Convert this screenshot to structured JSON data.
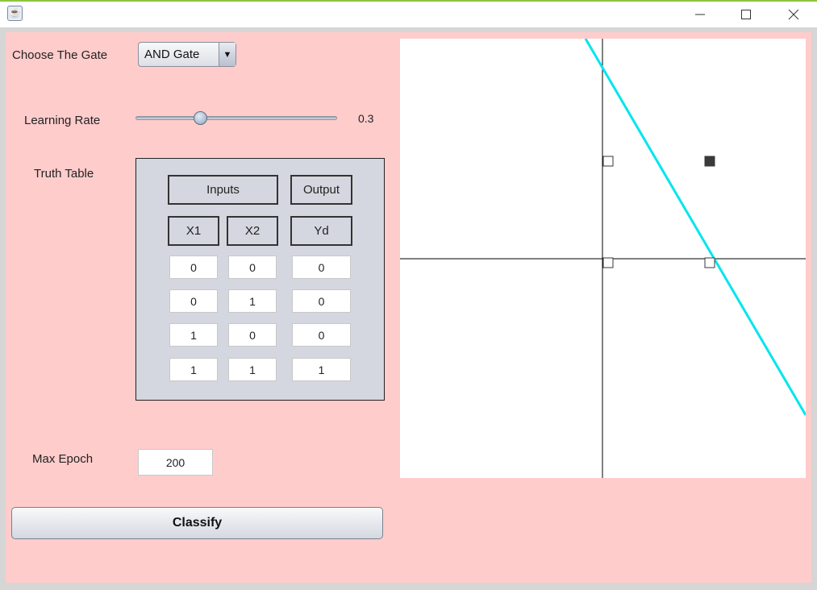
{
  "window": {
    "title": "",
    "minimize_glyph": "—",
    "maximize_glyph": "☐",
    "close_glyph": "✕"
  },
  "controls": {
    "gate_label": "Choose The Gate",
    "gate_selected": "AND Gate",
    "gate_arrow": "▼",
    "learning_rate_label": "Learning Rate",
    "learning_rate_value": "0.3",
    "learning_rate_fraction": 0.3,
    "truth_table_label": "Truth Table",
    "max_epoch_label": "Max Epoch",
    "max_epoch_value": "200",
    "classify_label": "Classify"
  },
  "truth_table": {
    "header_inputs": "Inputs",
    "header_output": "Output",
    "col_x1": "X1",
    "col_x2": "X2",
    "col_yd": "Yd",
    "rows": [
      [
        "0",
        "0",
        "0"
      ],
      [
        "0",
        "1",
        "0"
      ],
      [
        "1",
        "0",
        "0"
      ],
      [
        "1",
        "1",
        "1"
      ]
    ]
  },
  "plot": {
    "line_color": "#00e5ee",
    "axis_color": "#000000",
    "points": [
      {
        "x": 0,
        "y": 0,
        "class": 0
      },
      {
        "x": 0,
        "y": 1,
        "class": 0
      },
      {
        "x": 1,
        "y": 0,
        "class": 0
      },
      {
        "x": 1,
        "y": 1,
        "class": 1
      }
    ]
  }
}
